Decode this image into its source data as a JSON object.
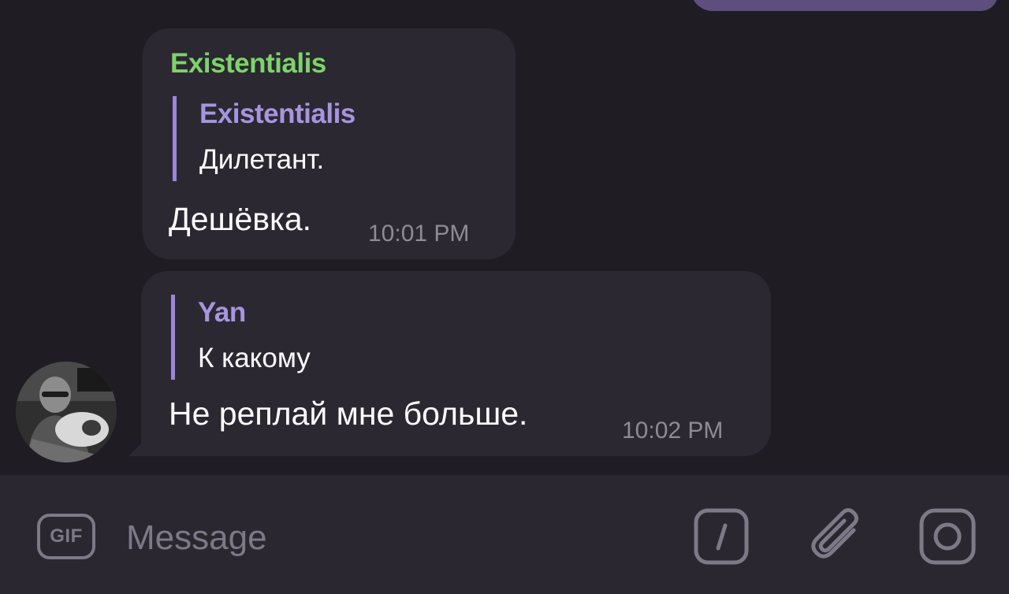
{
  "messages": [
    {
      "sender": "Existentialis",
      "reply": {
        "author": "Existentialis",
        "text": "Дилетант."
      },
      "text": "Дешёвка.",
      "time": "10:01 PM"
    },
    {
      "reply": {
        "author": "Yan",
        "text": "К какому"
      },
      "text": "Не реплай мне больше.",
      "time": "10:02 PM"
    }
  ],
  "composer": {
    "gif_label": "GIF",
    "placeholder": "Message"
  },
  "colors": {
    "background": "#1f1c24",
    "bubble": "#2b2831",
    "own_bubble": "#5e4e7d",
    "sender_name": "#7ed36a",
    "reply_accent": "#9d86d8",
    "time": "#8f8a98",
    "composer": "#2a2730"
  },
  "icons": {
    "commands": "slash-command-icon",
    "attach": "paperclip-icon",
    "camera": "camera-icon",
    "avatar": "user-avatar"
  }
}
